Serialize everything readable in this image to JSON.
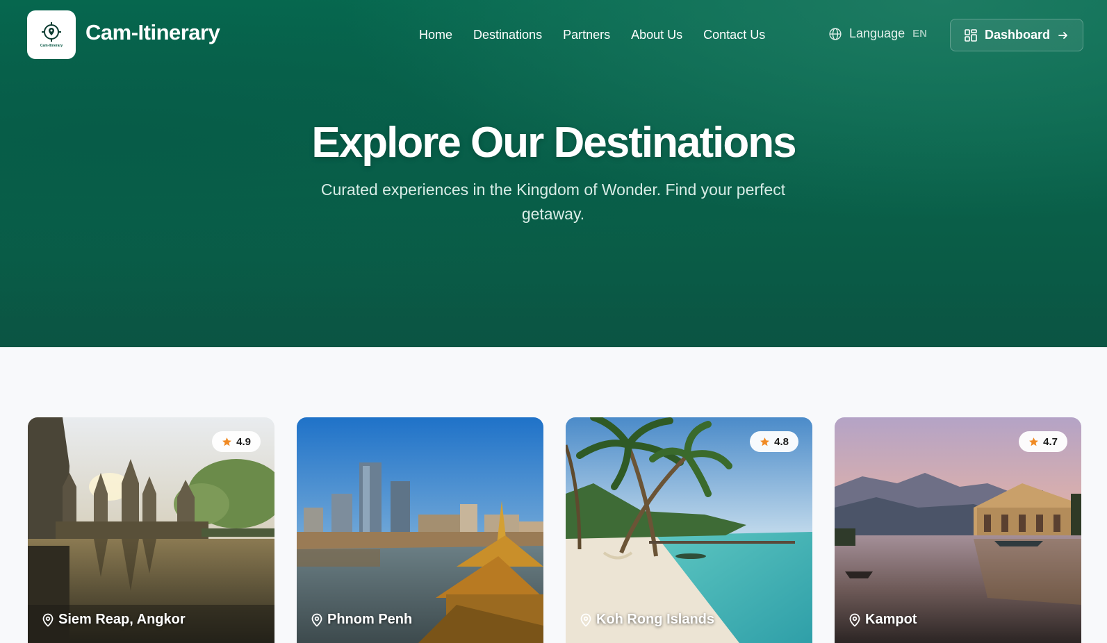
{
  "brand": {
    "name": "Cam-Itinerary",
    "logo_text": "Cam-Itinerary"
  },
  "nav": {
    "items": [
      "Home",
      "Destinations",
      "Partners",
      "About Us",
      "Contact Us"
    ]
  },
  "language": {
    "label": "Language",
    "code": "EN",
    "icon": "globe-icon"
  },
  "dashboard": {
    "label": "Dashboard",
    "icon": "grid-icon",
    "arrow_icon": "arrow-right-icon"
  },
  "hero": {
    "title": "Explore Our Destinations",
    "subtitle": "Curated experiences in the Kingdom of Wonder. Find your perfect getaway."
  },
  "colors": {
    "primary": "#066a50",
    "star": "#f08a24",
    "background": "#f8f9fb"
  },
  "destinations": [
    {
      "name": "Siem Reap, Angkor",
      "rating": "4.9",
      "icon": "map-pin-icon"
    },
    {
      "name": "Phnom Penh",
      "rating": "",
      "icon": "map-pin-icon"
    },
    {
      "name": "Koh Rong Islands",
      "rating": "4.8",
      "icon": "map-pin-icon"
    },
    {
      "name": "Kampot",
      "rating": "4.7",
      "icon": "map-pin-icon"
    }
  ]
}
